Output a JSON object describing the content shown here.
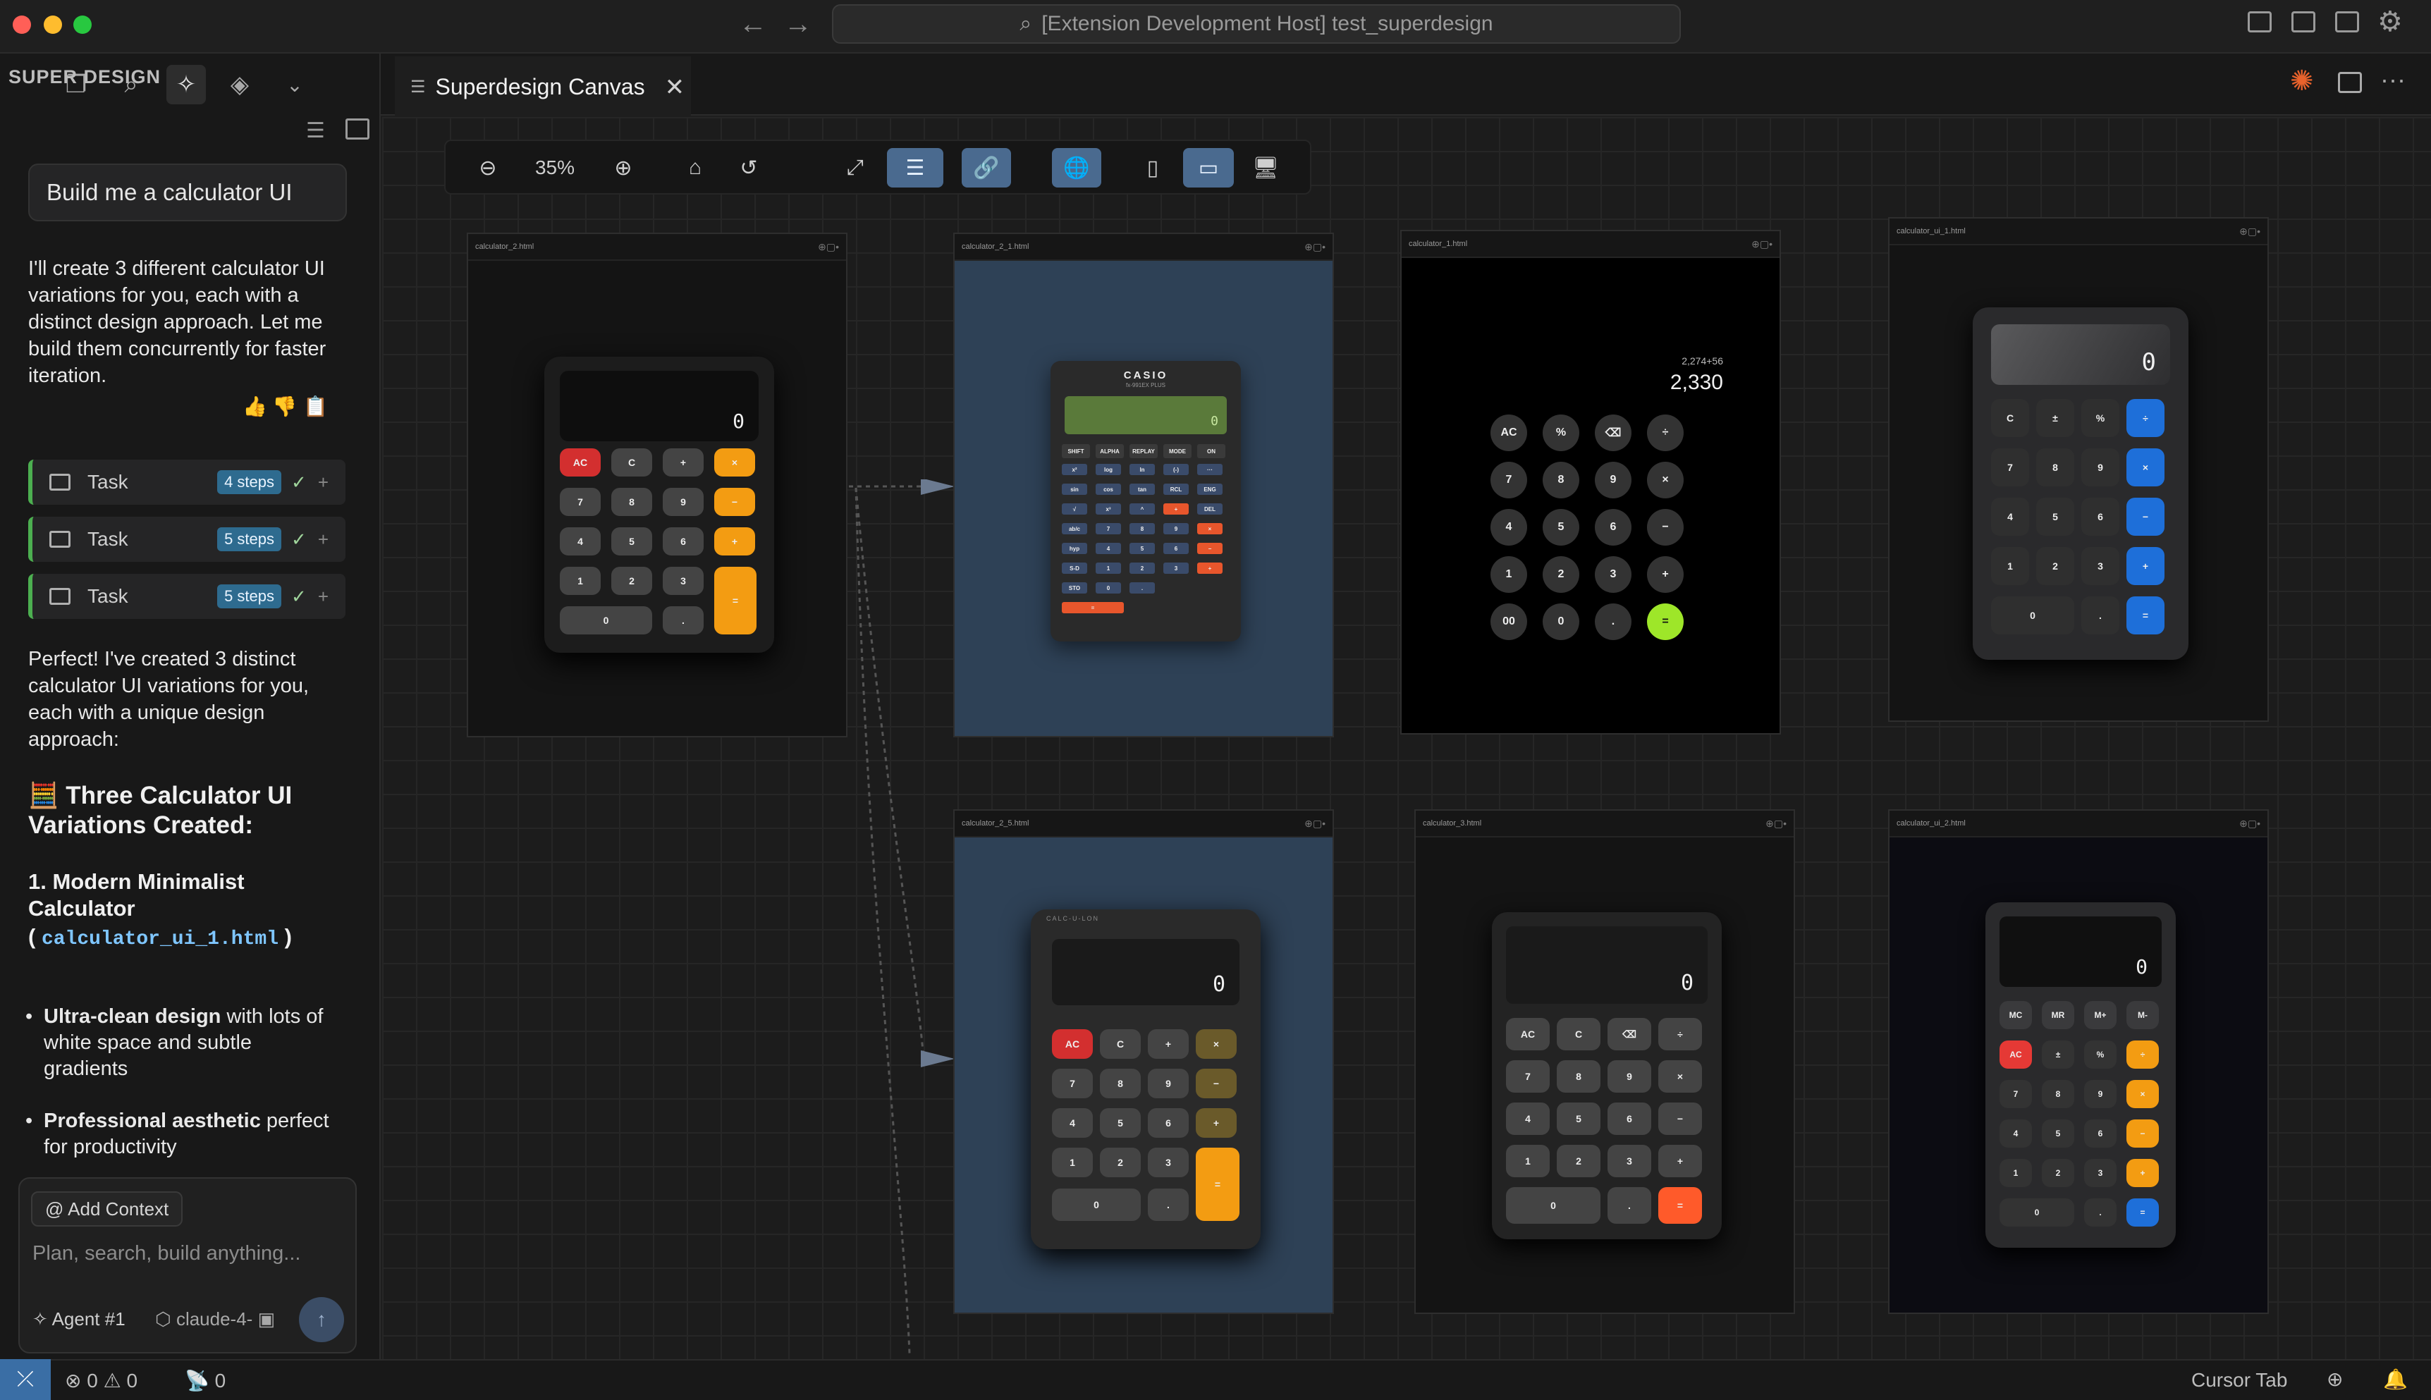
{
  "window": {
    "title": "[Extension Development Host] test_superdesign"
  },
  "sidebar": {
    "title": "SUPER DESIGN",
    "prompt": "Build me a calculator UI",
    "intro": "I'll create 3 different calculator UI variations for you, each with a distinct design approach. Let me build them concurrently for faster iteration.",
    "tasks": [
      {
        "label": "Task",
        "steps": "4 steps"
      },
      {
        "label": "Task",
        "steps": "5 steps"
      },
      {
        "label": "Task",
        "steps": "5 steps"
      }
    ],
    "done": "Perfect! I've created 3 distinct calculator UI variations for you, each with a unique design approach:",
    "heading": "🧮 Three Calculator UI Variations Created:",
    "item1_title": "1. Modern Minimalist Calculator",
    "item1_file": "calculator_ui_1.html",
    "bullets": [
      {
        "bold": "Ultra-clean design",
        "rest": " with lots of white space and subtle gradients"
      },
      {
        "bold": "Professional aesthetic",
        "rest": " perfect for productivity"
      }
    ],
    "add_context": "@ Add Context",
    "chat_placeholder": "Plan, search, build anything...",
    "agent": "Agent #1",
    "model": "claude-4-"
  },
  "tab": {
    "label": "Superdesign Canvas"
  },
  "toolbar": {
    "zoom": "35%"
  },
  "frames": [
    {
      "name": "calculator_2.html"
    },
    {
      "name": "calculator_2_1.html"
    },
    {
      "name": "calculator_1.html"
    },
    {
      "name": "calculator_ui_1.html"
    },
    {
      "name": "calculator_2_5.html"
    },
    {
      "name": "calculator_3.html"
    },
    {
      "name": "calculator_ui_2.html"
    }
  ],
  "calc1": {
    "display": "0",
    "keys": [
      "AC",
      "C",
      "+",
      "×",
      "7",
      "8",
      "9",
      "−",
      "4",
      "5",
      "6",
      "+",
      "1",
      "2",
      "3",
      "=",
      "0",
      "."
    ]
  },
  "calc2": {
    "brand": "CASIO",
    "sub": "fx-991EX PLUS",
    "display": "0",
    "keys": [
      "SHIFT",
      "ALPHA",
      "REPLAY",
      "MODE",
      "ON",
      "x²",
      "log",
      "ln",
      "(-)",
      "···",
      "sin",
      "cos",
      "tan",
      "RCL",
      "ENG",
      "√",
      "x³",
      "^",
      "+",
      "DEL",
      "ab/c",
      "7",
      "8",
      "9",
      "×",
      "hyp",
      "4",
      "5",
      "6",
      "−",
      "S-D",
      "1",
      "2",
      "3",
      "+",
      "STO",
      "0",
      ".",
      "="
    ]
  },
  "calc3": {
    "expr": "2,274+56",
    "display": "2,330",
    "keys": [
      "AC",
      "%",
      "⌫",
      "÷",
      "7",
      "8",
      "9",
      "×",
      "4",
      "5",
      "6",
      "−",
      "1",
      "2",
      "3",
      "+",
      "00",
      "0",
      ".",
      "="
    ]
  },
  "calc4": {
    "display": "0",
    "keys": [
      "C",
      "±",
      "%",
      "÷",
      "7",
      "8",
      "9",
      "×",
      "4",
      "5",
      "6",
      "−",
      "1",
      "2",
      "3",
      "+",
      "0",
      ".",
      "="
    ]
  },
  "calc5": {
    "brand": "CALC-U-LON",
    "display": "0",
    "keys": [
      "AC",
      "C",
      "+",
      "×",
      "7",
      "8",
      "9",
      "−",
      "4",
      "5",
      "6",
      "+",
      "1",
      "2",
      "3",
      "=",
      "0",
      "."
    ]
  },
  "calc6": {
    "display": "0",
    "keys": [
      "AC",
      "C",
      "⌫",
      "÷",
      "7",
      "8",
      "9",
      "×",
      "4",
      "5",
      "6",
      "−",
      "1",
      "2",
      "3",
      "+",
      "0",
      ".",
      "="
    ]
  },
  "calc7": {
    "display": "0",
    "keys": [
      "MC",
      "MR",
      "M+",
      "M-",
      "AC",
      "±",
      "%",
      "÷",
      "7",
      "8",
      "9",
      "×",
      "4",
      "5",
      "6",
      "−",
      "1",
      "2",
      "3",
      "+",
      "0",
      ".",
      "="
    ]
  },
  "status": {
    "errors": "0",
    "warnings": "0",
    "ports": "0",
    "right": "Cursor Tab"
  }
}
